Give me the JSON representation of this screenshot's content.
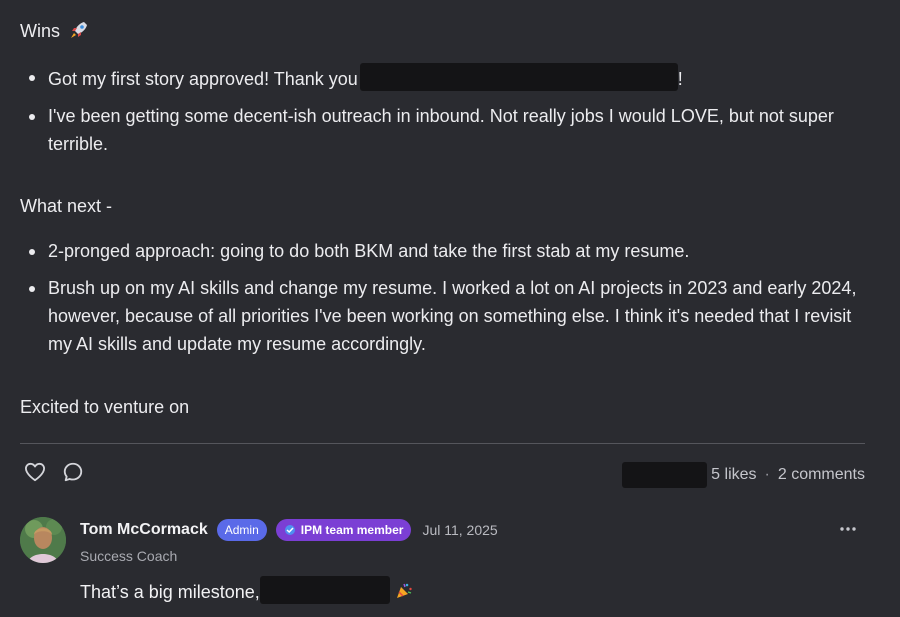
{
  "post": {
    "wins_heading": "Wins",
    "wins_emoji": "rocket-icon",
    "wins": [
      {
        "text_before": "Got my first story approved! Thank you",
        "text_after": "!"
      },
      {
        "text": "I've been getting some decent-ish outreach in inbound. Not really jobs I would LOVE, but not super terrible."
      }
    ],
    "next_heading": "What next -",
    "next": [
      "2-pronged approach: going to do both BKM and take the first stab at my resume.",
      "Brush up on my AI skills and change my resume. I worked a lot on AI projects in 2023 and early 2024, however, because of all priorities I've been working on something else. I think it's needed that I revisit my AI skills and update my resume accordingly."
    ],
    "closing": "Excited to venture on"
  },
  "actions": {
    "likes": "5 likes",
    "separator": "·",
    "comments": "2 comments"
  },
  "comment": {
    "author": "Tom McCormack",
    "badge_admin": "Admin",
    "badge_team": "IPM team member",
    "date": "Jul 11, 2025",
    "role": "Success Coach",
    "text": "That’s a big milestone,",
    "emoji": "party-popper-icon"
  },
  "colors": {
    "background": "#2a2b30",
    "admin_badge": "#5a6ae8",
    "team_badge": "#7b3fd4",
    "redaction": "#141416"
  }
}
